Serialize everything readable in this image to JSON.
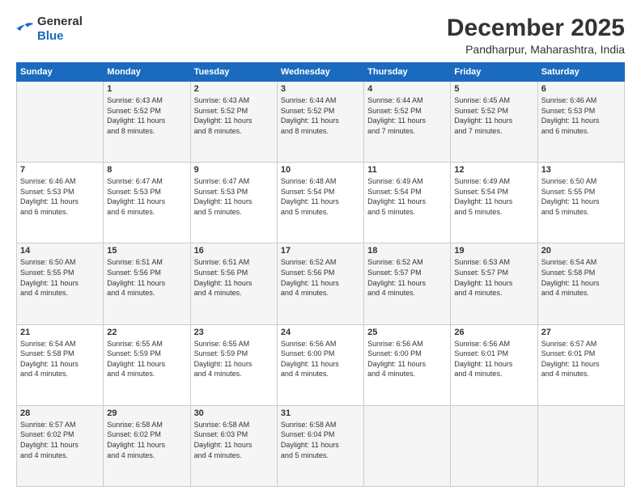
{
  "header": {
    "logo": {
      "general": "General",
      "blue": "Blue"
    },
    "title": "December 2025",
    "location": "Pandharpur, Maharashtra, India"
  },
  "calendar": {
    "weekdays": [
      "Sunday",
      "Monday",
      "Tuesday",
      "Wednesday",
      "Thursday",
      "Friday",
      "Saturday"
    ],
    "weeks": [
      [
        {
          "day": "",
          "info": ""
        },
        {
          "day": "1",
          "info": "Sunrise: 6:43 AM\nSunset: 5:52 PM\nDaylight: 11 hours\nand 8 minutes."
        },
        {
          "day": "2",
          "info": "Sunrise: 6:43 AM\nSunset: 5:52 PM\nDaylight: 11 hours\nand 8 minutes."
        },
        {
          "day": "3",
          "info": "Sunrise: 6:44 AM\nSunset: 5:52 PM\nDaylight: 11 hours\nand 8 minutes."
        },
        {
          "day": "4",
          "info": "Sunrise: 6:44 AM\nSunset: 5:52 PM\nDaylight: 11 hours\nand 7 minutes."
        },
        {
          "day": "5",
          "info": "Sunrise: 6:45 AM\nSunset: 5:52 PM\nDaylight: 11 hours\nand 7 minutes."
        },
        {
          "day": "6",
          "info": "Sunrise: 6:46 AM\nSunset: 5:53 PM\nDaylight: 11 hours\nand 6 minutes."
        }
      ],
      [
        {
          "day": "7",
          "info": "Sunrise: 6:46 AM\nSunset: 5:53 PM\nDaylight: 11 hours\nand 6 minutes."
        },
        {
          "day": "8",
          "info": "Sunrise: 6:47 AM\nSunset: 5:53 PM\nDaylight: 11 hours\nand 6 minutes."
        },
        {
          "day": "9",
          "info": "Sunrise: 6:47 AM\nSunset: 5:53 PM\nDaylight: 11 hours\nand 5 minutes."
        },
        {
          "day": "10",
          "info": "Sunrise: 6:48 AM\nSunset: 5:54 PM\nDaylight: 11 hours\nand 5 minutes."
        },
        {
          "day": "11",
          "info": "Sunrise: 6:49 AM\nSunset: 5:54 PM\nDaylight: 11 hours\nand 5 minutes."
        },
        {
          "day": "12",
          "info": "Sunrise: 6:49 AM\nSunset: 5:54 PM\nDaylight: 11 hours\nand 5 minutes."
        },
        {
          "day": "13",
          "info": "Sunrise: 6:50 AM\nSunset: 5:55 PM\nDaylight: 11 hours\nand 5 minutes."
        }
      ],
      [
        {
          "day": "14",
          "info": "Sunrise: 6:50 AM\nSunset: 5:55 PM\nDaylight: 11 hours\nand 4 minutes."
        },
        {
          "day": "15",
          "info": "Sunrise: 6:51 AM\nSunset: 5:56 PM\nDaylight: 11 hours\nand 4 minutes."
        },
        {
          "day": "16",
          "info": "Sunrise: 6:51 AM\nSunset: 5:56 PM\nDaylight: 11 hours\nand 4 minutes."
        },
        {
          "day": "17",
          "info": "Sunrise: 6:52 AM\nSunset: 5:56 PM\nDaylight: 11 hours\nand 4 minutes."
        },
        {
          "day": "18",
          "info": "Sunrise: 6:52 AM\nSunset: 5:57 PM\nDaylight: 11 hours\nand 4 minutes."
        },
        {
          "day": "19",
          "info": "Sunrise: 6:53 AM\nSunset: 5:57 PM\nDaylight: 11 hours\nand 4 minutes."
        },
        {
          "day": "20",
          "info": "Sunrise: 6:54 AM\nSunset: 5:58 PM\nDaylight: 11 hours\nand 4 minutes."
        }
      ],
      [
        {
          "day": "21",
          "info": "Sunrise: 6:54 AM\nSunset: 5:58 PM\nDaylight: 11 hours\nand 4 minutes."
        },
        {
          "day": "22",
          "info": "Sunrise: 6:55 AM\nSunset: 5:59 PM\nDaylight: 11 hours\nand 4 minutes."
        },
        {
          "day": "23",
          "info": "Sunrise: 6:55 AM\nSunset: 5:59 PM\nDaylight: 11 hours\nand 4 minutes."
        },
        {
          "day": "24",
          "info": "Sunrise: 6:56 AM\nSunset: 6:00 PM\nDaylight: 11 hours\nand 4 minutes."
        },
        {
          "day": "25",
          "info": "Sunrise: 6:56 AM\nSunset: 6:00 PM\nDaylight: 11 hours\nand 4 minutes."
        },
        {
          "day": "26",
          "info": "Sunrise: 6:56 AM\nSunset: 6:01 PM\nDaylight: 11 hours\nand 4 minutes."
        },
        {
          "day": "27",
          "info": "Sunrise: 6:57 AM\nSunset: 6:01 PM\nDaylight: 11 hours\nand 4 minutes."
        }
      ],
      [
        {
          "day": "28",
          "info": "Sunrise: 6:57 AM\nSunset: 6:02 PM\nDaylight: 11 hours\nand 4 minutes."
        },
        {
          "day": "29",
          "info": "Sunrise: 6:58 AM\nSunset: 6:02 PM\nDaylight: 11 hours\nand 4 minutes."
        },
        {
          "day": "30",
          "info": "Sunrise: 6:58 AM\nSunset: 6:03 PM\nDaylight: 11 hours\nand 4 minutes."
        },
        {
          "day": "31",
          "info": "Sunrise: 6:58 AM\nSunset: 6:04 PM\nDaylight: 11 hours\nand 5 minutes."
        },
        {
          "day": "",
          "info": ""
        },
        {
          "day": "",
          "info": ""
        },
        {
          "day": "",
          "info": ""
        }
      ]
    ]
  }
}
